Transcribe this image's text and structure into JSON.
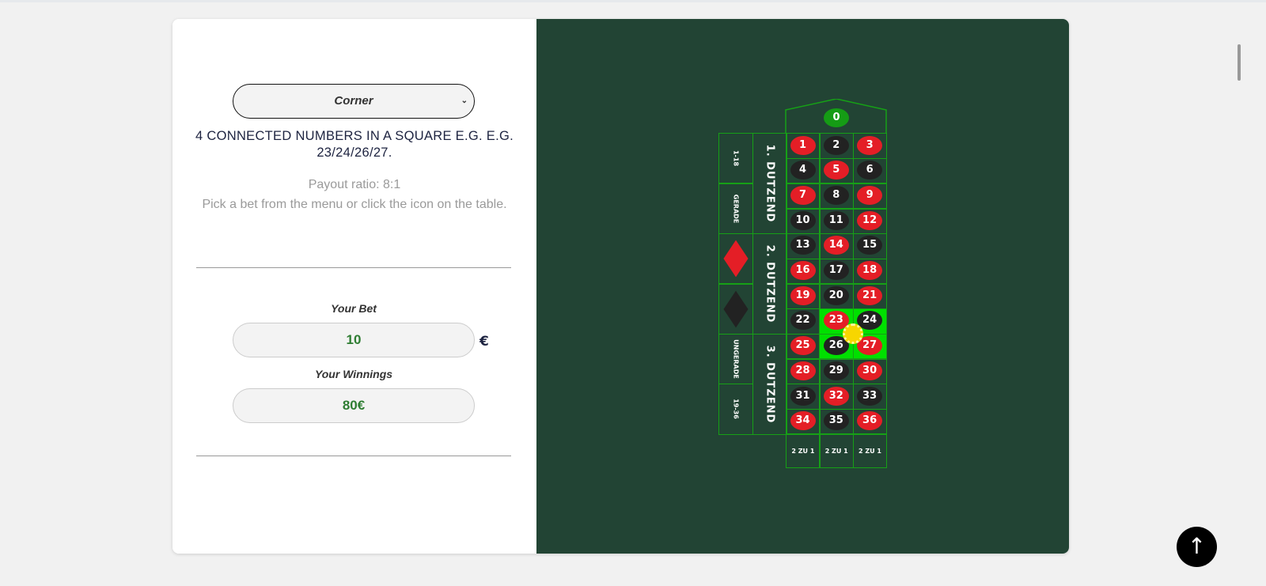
{
  "bet_select": {
    "value": "Corner"
  },
  "description": "4 CONNECTED NUMBERS IN A SQUARE E.G. E.G. 23/24/26/27.",
  "payout": "Payout ratio: 8:1",
  "hint": "Pick a bet from the menu or click the icon on the table.",
  "your_bet": {
    "label": "Your Bet",
    "value": "10",
    "currency": "€"
  },
  "your_winnings": {
    "label": "Your Winnings",
    "value": "80€"
  },
  "table": {
    "zero": "0",
    "numbers": [
      1,
      2,
      3,
      4,
      5,
      6,
      7,
      8,
      9,
      10,
      11,
      12,
      13,
      14,
      15,
      16,
      17,
      18,
      19,
      20,
      21,
      22,
      23,
      24,
      25,
      26,
      27,
      28,
      29,
      30,
      31,
      32,
      33,
      34,
      35,
      36
    ],
    "red": [
      1,
      3,
      5,
      7,
      9,
      12,
      14,
      16,
      18,
      19,
      21,
      23,
      25,
      27,
      28,
      30,
      32,
      34,
      36
    ],
    "highlighted": [
      23,
      24,
      26,
      27
    ],
    "outside": [
      "1-18",
      "GERADE",
      "",
      "",
      "UNGERADE",
      "19-36"
    ],
    "dozens": [
      "1. DUTZEND",
      "2. DUTZEND",
      "3. DUTZEND"
    ],
    "columns": [
      "2 ZU 1",
      "2 ZU 1",
      "2 ZU 1"
    ],
    "colors": {
      "red": "#e41e26",
      "black": "#222222",
      "highlight": "#00e000",
      "felt": "#224434",
      "zero": "#159c15",
      "chip": "#f7d600"
    }
  },
  "scroll_top_icon": "arrow-up-icon"
}
